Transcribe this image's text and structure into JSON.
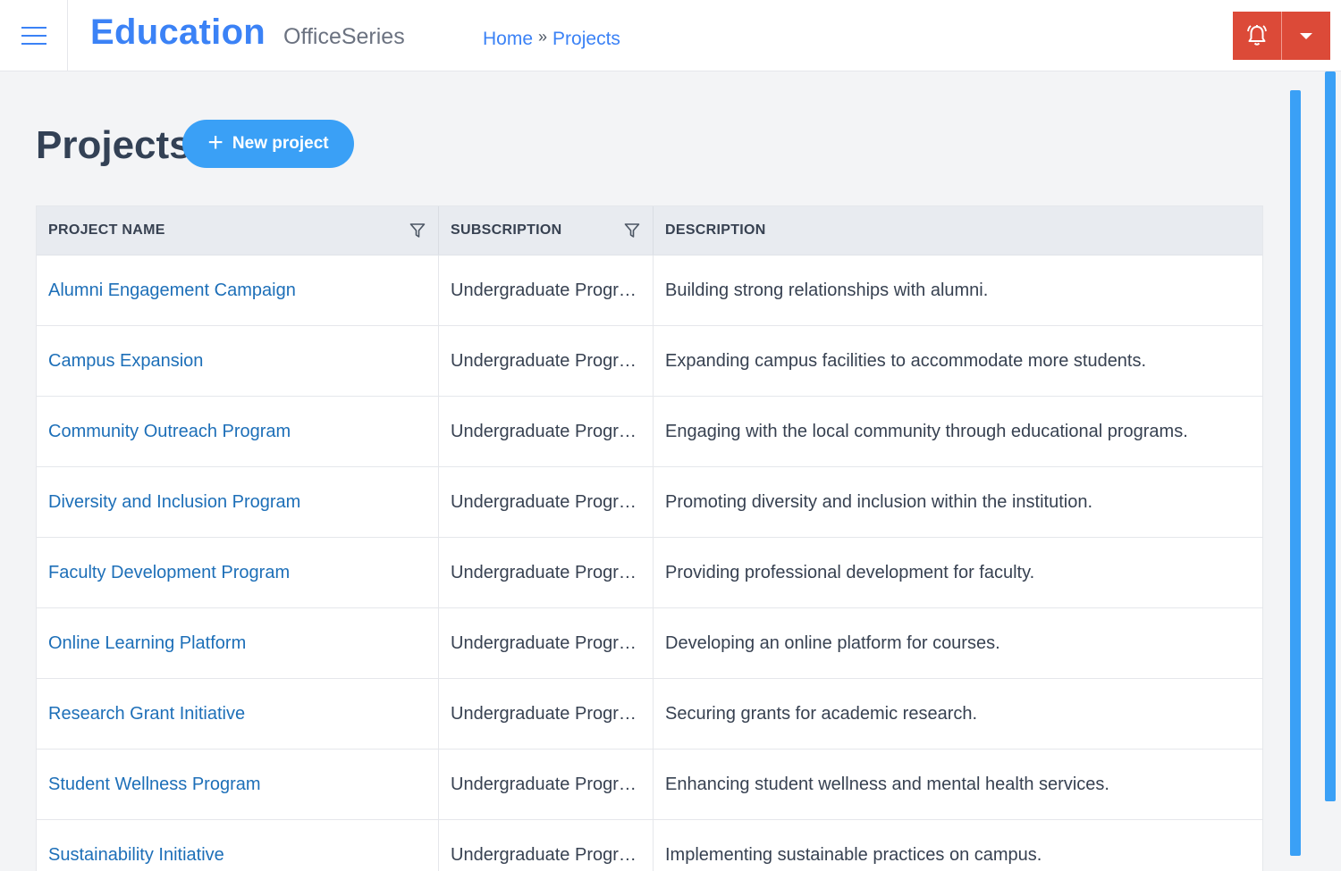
{
  "header": {
    "brand": "Education",
    "sub_brand": "OfficeSeries",
    "breadcrumb": [
      {
        "label": "Home"
      },
      {
        "label": "Projects"
      }
    ],
    "breadcrumb_separator": "»",
    "icons": {
      "menu": "hamburger-menu-icon",
      "alert": "bell-alert-icon",
      "dropdown": "caret-down-icon"
    },
    "accent_color": "#3b82f6",
    "alert_color": "#dc4a38"
  },
  "page": {
    "title": "Projects",
    "new_button": {
      "plus": "+",
      "label": "New project"
    }
  },
  "table": {
    "columns": [
      {
        "label": "PROJECT NAME",
        "filterable": true
      },
      {
        "label": "SUBSCRIPTION",
        "filterable": true
      },
      {
        "label": "DESCRIPTION",
        "filterable": false
      }
    ],
    "rows": [
      {
        "name": "Alumni Engagement Campaign",
        "subscription": "Undergraduate Programs",
        "description": "Building strong relationships with alumni."
      },
      {
        "name": "Campus Expansion",
        "subscription": "Undergraduate Programs",
        "description": "Expanding campus facilities to accommodate more students."
      },
      {
        "name": "Community Outreach Program",
        "subscription": "Undergraduate Programs",
        "description": "Engaging with the local community through educational programs."
      },
      {
        "name": "Diversity and Inclusion Program",
        "subscription": "Undergraduate Programs",
        "description": "Promoting diversity and inclusion within the institution."
      },
      {
        "name": "Faculty Development Program",
        "subscription": "Undergraduate Programs",
        "description": "Providing professional development for faculty."
      },
      {
        "name": "Online Learning Platform",
        "subscription": "Undergraduate Programs",
        "description": "Developing an online platform for courses."
      },
      {
        "name": "Research Grant Initiative",
        "subscription": "Undergraduate Programs",
        "description": "Securing grants for academic research."
      },
      {
        "name": "Student Wellness Program",
        "subscription": "Undergraduate Programs",
        "description": "Enhancing student wellness and mental health services."
      },
      {
        "name": "Sustainability Initiative",
        "subscription": "Undergraduate Programs",
        "description": "Implementing sustainable practices on campus."
      }
    ]
  }
}
